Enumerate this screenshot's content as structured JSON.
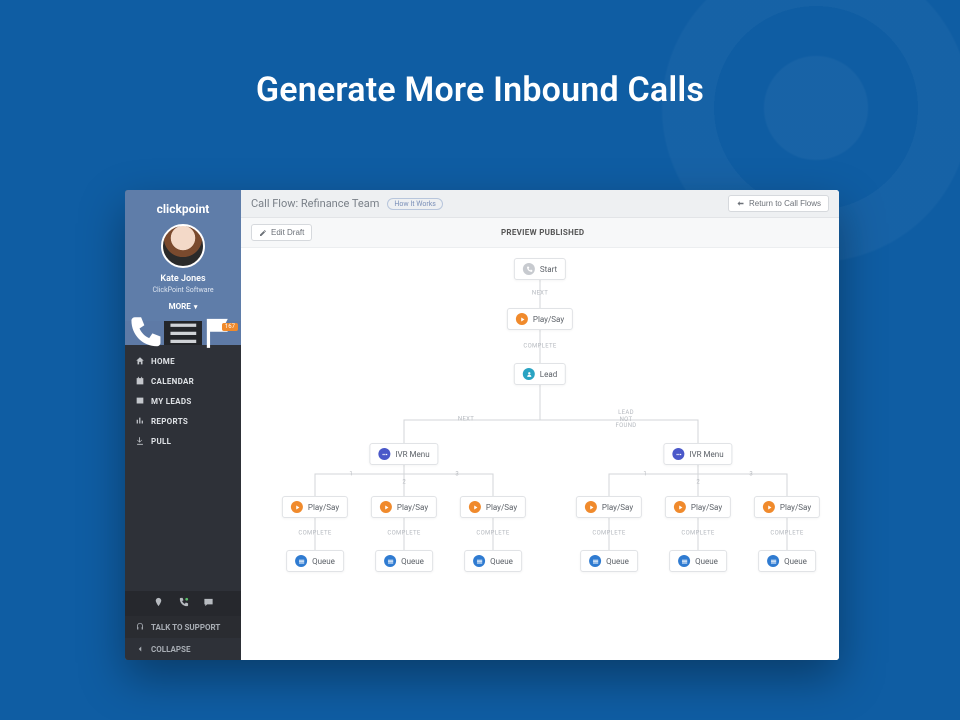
{
  "hero": {
    "title": "Generate More Inbound Calls"
  },
  "brand": "clickpoint",
  "user": {
    "name": "Kate Jones",
    "org": "ClickPoint Software",
    "more": "MORE"
  },
  "tabstrip": {
    "badge": "167"
  },
  "nav": {
    "home": "HOME",
    "calendar": "CALENDAR",
    "myleads": "MY LEADS",
    "reports": "REPORTS",
    "pull": "PULL"
  },
  "sidebar_footer": {
    "talk": "TALK TO SUPPORT",
    "collapse": "COLLAPSE"
  },
  "titlebar": {
    "title": "Call Flow: Refinance Team",
    "how": "How It Works",
    "return": "Return to Call Flows"
  },
  "subbar": {
    "edit": "Edit Draft",
    "preview": "PREVIEW PUBLISHED"
  },
  "flow": {
    "start": "Start",
    "playsay": "Play/Say",
    "lead": "Lead",
    "ivr": "IVR Menu",
    "queue": "Queue",
    "labels": {
      "next": "NEXT",
      "complete": "COMPLETE",
      "lead_not_found": "LEAD\nNOT\nFOUND",
      "n1": "1",
      "n2": "2",
      "n3": "3"
    }
  }
}
